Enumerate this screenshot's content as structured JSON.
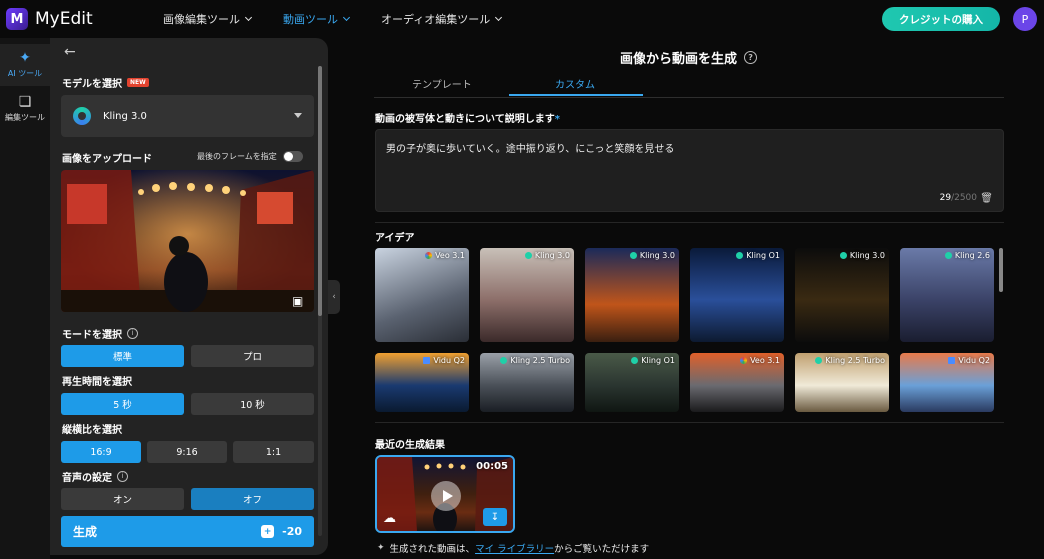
{
  "app": {
    "name": "MyEdit",
    "logo_letter": "M"
  },
  "nav": {
    "items": [
      {
        "label": "画像編集ツール",
        "active": false
      },
      {
        "label": "動画ツール",
        "active": true
      },
      {
        "label": "オーディオ編集ツール",
        "active": false
      }
    ]
  },
  "header": {
    "buy_credits": "クレジットの購入",
    "avatar_letter": "P"
  },
  "rail": {
    "items": [
      {
        "label": "AI ツール",
        "icon": "magic-wand-icon",
        "active": true
      },
      {
        "label": "編集ツール",
        "icon": "layers-icon",
        "active": false
      }
    ]
  },
  "panel": {
    "model_label": "モデルを選択",
    "new_badge": "NEW",
    "model_name": "Kling 3.0",
    "upload_label": "画像をアップロード",
    "last_frame_label": "最後のフレームを指定",
    "mode_label": "モードを選択",
    "mode_options": [
      "標準",
      "プロ"
    ],
    "mode_selected": 0,
    "duration_label": "再生時間を選択",
    "duration_options": [
      "5 秒",
      "10 秒"
    ],
    "duration_selected": 0,
    "aspect_label": "縦横比を選択",
    "aspect_options": [
      "16:9",
      "9:16",
      "1:1"
    ],
    "aspect_selected": 0,
    "audio_label": "音声の設定",
    "audio_options": [
      "オン",
      "オフ"
    ],
    "audio_selected": 1,
    "generate_label": "生成",
    "generate_cost": "-20"
  },
  "main": {
    "title": "画像から動画を生成",
    "tabs": [
      "テンプレート",
      "カスタム"
    ],
    "active_tab": 1,
    "prompt_label": "動画の被写体と動きについて説明します",
    "required_mark": "*",
    "prompt_text": "男の子が奥に歩いていく。途中振り返り、にこっと笑顔を見せる",
    "char_count": "29",
    "char_max": "/2500",
    "ideas_label": "アイデア",
    "ideas": [
      {
        "badge": "Veo 3.1",
        "kind": "veo"
      },
      {
        "badge": "Kling 3.0",
        "kind": "kling"
      },
      {
        "badge": "Kling 3.0",
        "kind": "kling"
      },
      {
        "badge": "Kling O1",
        "kind": "kling"
      },
      {
        "badge": "Kling 3.0",
        "kind": "kling"
      },
      {
        "badge": "Kling 2.6",
        "kind": "kling"
      },
      {
        "badge": "Vidu Q2",
        "kind": "vidu"
      },
      {
        "badge": "Kling 2.5 Turbo",
        "kind": "kling"
      },
      {
        "badge": "Kling O1",
        "kind": "kling"
      },
      {
        "badge": "Veo 3.1",
        "kind": "veo"
      },
      {
        "badge": "Kling 2.5 Turbo",
        "kind": "kling"
      },
      {
        "badge": "Vidu Q2",
        "kind": "vidu"
      }
    ],
    "recent_label": "最近の生成結果",
    "recent_duration": "00:05",
    "footnote_prefix": "生成された動画は、",
    "footnote_link": "マイ ライブラリー",
    "footnote_suffix": "からご覧いただけます"
  }
}
